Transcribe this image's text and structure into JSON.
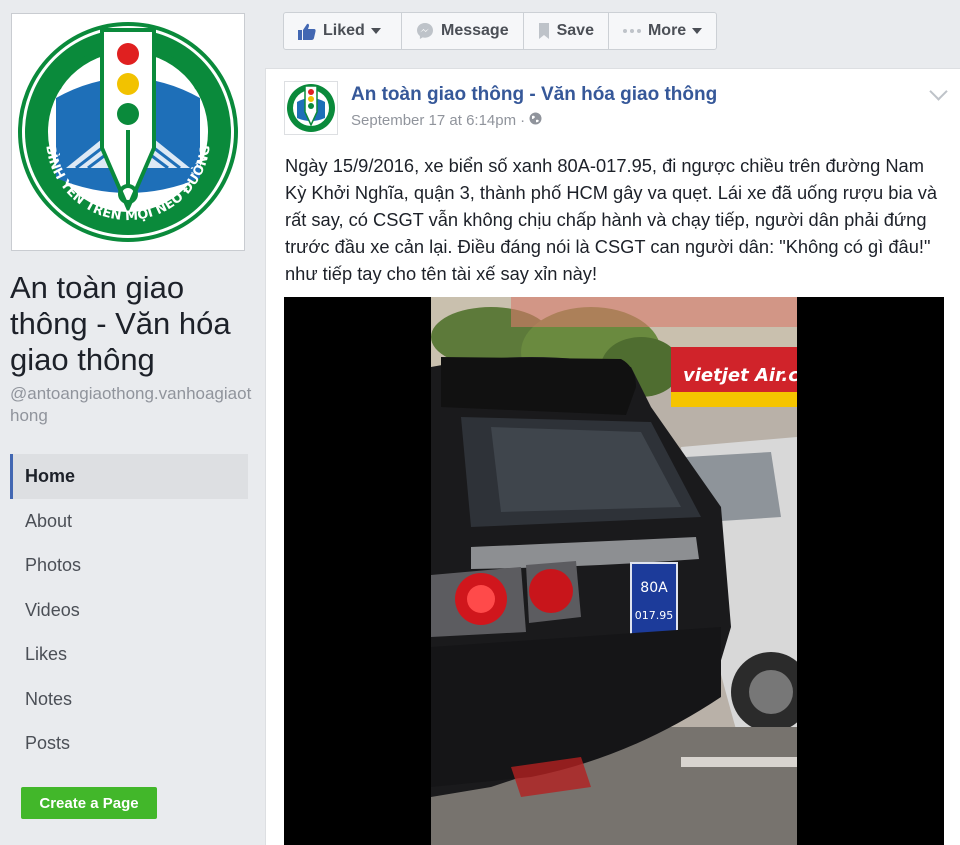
{
  "sidebar": {
    "logo_text": "BÌNH YÊN TRÊN MỌI NẺO ĐƯỜNG",
    "page_name": "An toàn giao thông - Văn hóa giao thông",
    "handle": "@antoangiaothong.vanhoagiaothong",
    "nav": [
      {
        "label": "Home",
        "active": true
      },
      {
        "label": "About"
      },
      {
        "label": "Photos"
      },
      {
        "label": "Videos"
      },
      {
        "label": "Likes"
      },
      {
        "label": "Notes"
      },
      {
        "label": "Posts"
      }
    ],
    "create_page_label": "Create a Page"
  },
  "actionbar": {
    "liked": "Liked",
    "message": "Message",
    "save": "Save",
    "more": "More"
  },
  "post": {
    "author": "An toàn giao thông - Văn hóa giao thông",
    "date": "September 17 at 6:14pm",
    "separator": "·",
    "text": "Ngày 15/9/2016, xe biển số xanh 80A-017.95, đi ngược chiều trên đường Nam Kỳ Khởi Nghĩa, quận 3, thành phố HCM gây va quẹt. Lái xe đã uống rượu bia và rất say, có CSGT vẫn không chịu chấp hành và chạy tiếp, người dân phải đứng trước đầu xe cản lại. Điều đáng nói là CSGT can người dân: \"Không có gì đâu!\" như tiếp tay cho tên tài xế say xỉn này!",
    "video": {
      "plate_top": "80A",
      "plate_bottom": "017.95",
      "sign_text": "vietjet Air.com"
    }
  },
  "colors": {
    "link": "#365899",
    "green": "#42b72a",
    "logo_green": "#0a8a3b",
    "logo_blue": "#1e6fb8"
  }
}
